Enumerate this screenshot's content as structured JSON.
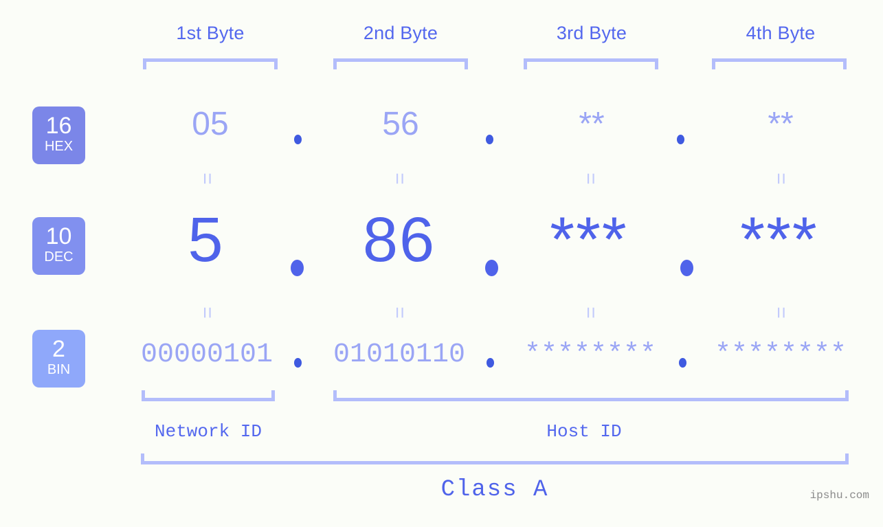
{
  "meta": {
    "watermark": "ipshu.com",
    "background_color": "#fbfdf8",
    "accent_color": "#4f63ea",
    "muted_accent_color": "#9aa5f5",
    "bracket_color": "#b3bdfb"
  },
  "byte_headers": [
    {
      "label": "1st Byte"
    },
    {
      "label": "2nd Byte"
    },
    {
      "label": "3rd Byte"
    },
    {
      "label": "4th Byte"
    }
  ],
  "bases": [
    {
      "id": "hex",
      "number": "16",
      "name": "HEX",
      "color": "#7b86e8"
    },
    {
      "id": "dec",
      "number": "10",
      "name": "DEC",
      "color": "#8190ef"
    },
    {
      "id": "bin",
      "number": "2",
      "name": "BIN",
      "color": "#8fa8fa"
    }
  ],
  "rows": {
    "hex": {
      "values": [
        "05",
        "56",
        "**",
        "**"
      ],
      "separator": "."
    },
    "dec": {
      "values": [
        "5",
        "86",
        "***",
        "***"
      ],
      "separator": "."
    },
    "bin": {
      "values": [
        "00000101",
        "01010110",
        "********",
        "********"
      ],
      "separator": "."
    }
  },
  "equals_separators": {
    "symbol": "="
  },
  "segments": {
    "network_id": "Network ID",
    "host_id": "Host ID"
  },
  "class": {
    "label": "Class A"
  }
}
